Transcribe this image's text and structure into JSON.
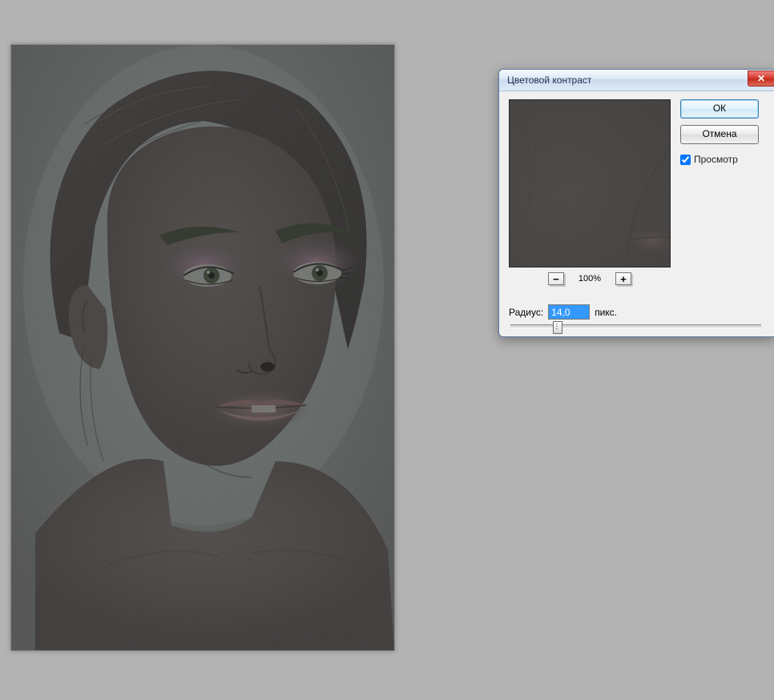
{
  "dialog": {
    "title": "Цветовой контраст",
    "close_glyph": "✕",
    "ok_label": "ОК",
    "cancel_label": "Отмена",
    "preview_checkbox_label": "Просмотр",
    "preview_checked": true,
    "zoom": {
      "minus_label": "−",
      "plus_label": "+",
      "value": "100%"
    },
    "radius": {
      "label": "Радиус:",
      "value": "14,0",
      "unit": "пикс."
    }
  },
  "colors": {
    "bg": "#b3b3b3",
    "dialog_border": "#5b7aa2",
    "close_red": "#d43b2a"
  }
}
